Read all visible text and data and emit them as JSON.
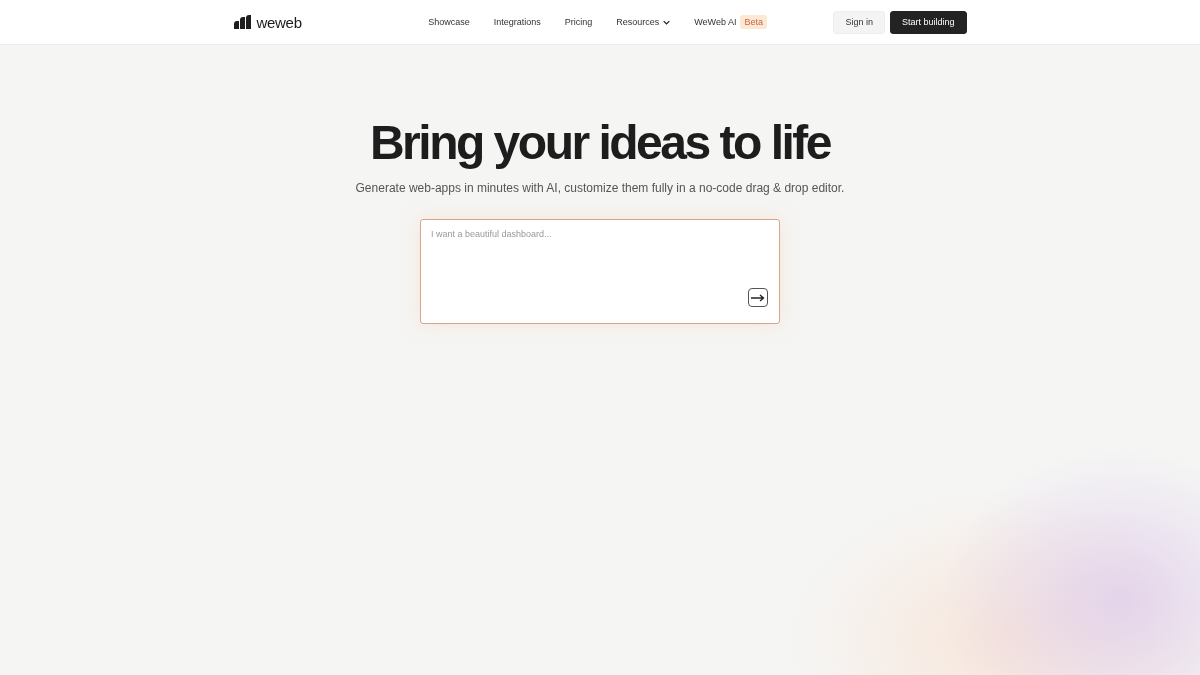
{
  "header": {
    "logo": {
      "text": "weweb"
    },
    "nav": [
      {
        "label": "Showcase",
        "kind": "link"
      },
      {
        "label": "Integrations",
        "kind": "link"
      },
      {
        "label": "Pricing",
        "kind": "link"
      },
      {
        "label": "Resources",
        "kind": "dropdown"
      },
      {
        "label": "WeWeb AI",
        "kind": "badge-link",
        "badge": "Beta"
      }
    ],
    "actions": [
      {
        "label": "Sign in",
        "kind": "secondary"
      },
      {
        "label": "Start building",
        "kind": "primary"
      }
    ]
  },
  "hero": {
    "title": "Bring your ideas to life",
    "subtitle": "Generate web-apps in minutes with AI, customize them fully in a no-code drag & drop editor.",
    "prompt": {
      "placeholder": "I want a beautiful dashboard..."
    }
  }
}
